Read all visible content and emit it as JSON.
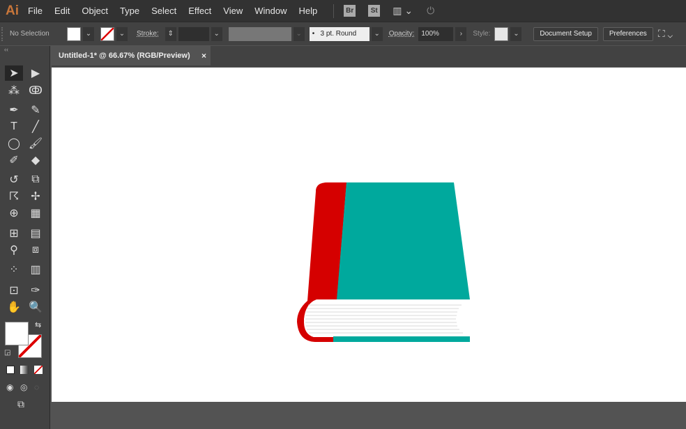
{
  "app": {
    "logo": "Ai",
    "menus": [
      "File",
      "Edit",
      "Object",
      "Type",
      "Select",
      "Effect",
      "View",
      "Window",
      "Help"
    ],
    "bridge": "Br",
    "stock": "St"
  },
  "control": {
    "selection": "No Selection",
    "stroke_label": "Stroke:",
    "brush": "3 pt. Round",
    "opacity_label": "Opacity:",
    "opacity": "100%",
    "style_label": "Style:",
    "doc_setup": "Document Setup",
    "preferences": "Preferences"
  },
  "tab": {
    "title": "Untitled-1* @ 66.67% (RGB/Preview)",
    "close": "×"
  },
  "colors": {
    "spine": "#d50000",
    "cover": "#00a99d",
    "pages_line": "#cccccc"
  }
}
